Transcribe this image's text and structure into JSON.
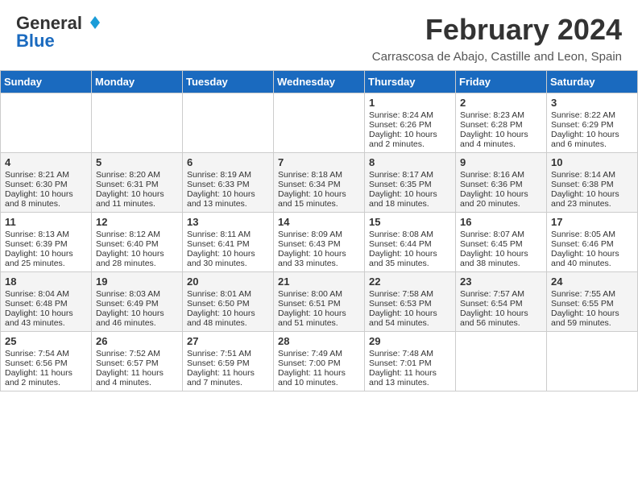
{
  "header": {
    "logo_general": "General",
    "logo_blue": "Blue",
    "month_title": "February 2024",
    "location": "Carrascosa de Abajo, Castille and Leon, Spain"
  },
  "days_of_week": [
    "Sunday",
    "Monday",
    "Tuesday",
    "Wednesday",
    "Thursday",
    "Friday",
    "Saturday"
  ],
  "weeks": [
    [
      {
        "day": "",
        "content": ""
      },
      {
        "day": "",
        "content": ""
      },
      {
        "day": "",
        "content": ""
      },
      {
        "day": "",
        "content": ""
      },
      {
        "day": "1",
        "content": "Sunrise: 8:24 AM\nSunset: 6:26 PM\nDaylight: 10 hours\nand 2 minutes."
      },
      {
        "day": "2",
        "content": "Sunrise: 8:23 AM\nSunset: 6:28 PM\nDaylight: 10 hours\nand 4 minutes."
      },
      {
        "day": "3",
        "content": "Sunrise: 8:22 AM\nSunset: 6:29 PM\nDaylight: 10 hours\nand 6 minutes."
      }
    ],
    [
      {
        "day": "4",
        "content": "Sunrise: 8:21 AM\nSunset: 6:30 PM\nDaylight: 10 hours\nand 8 minutes."
      },
      {
        "day": "5",
        "content": "Sunrise: 8:20 AM\nSunset: 6:31 PM\nDaylight: 10 hours\nand 11 minutes."
      },
      {
        "day": "6",
        "content": "Sunrise: 8:19 AM\nSunset: 6:33 PM\nDaylight: 10 hours\nand 13 minutes."
      },
      {
        "day": "7",
        "content": "Sunrise: 8:18 AM\nSunset: 6:34 PM\nDaylight: 10 hours\nand 15 minutes."
      },
      {
        "day": "8",
        "content": "Sunrise: 8:17 AM\nSunset: 6:35 PM\nDaylight: 10 hours\nand 18 minutes."
      },
      {
        "day": "9",
        "content": "Sunrise: 8:16 AM\nSunset: 6:36 PM\nDaylight: 10 hours\nand 20 minutes."
      },
      {
        "day": "10",
        "content": "Sunrise: 8:14 AM\nSunset: 6:38 PM\nDaylight: 10 hours\nand 23 minutes."
      }
    ],
    [
      {
        "day": "11",
        "content": "Sunrise: 8:13 AM\nSunset: 6:39 PM\nDaylight: 10 hours\nand 25 minutes."
      },
      {
        "day": "12",
        "content": "Sunrise: 8:12 AM\nSunset: 6:40 PM\nDaylight: 10 hours\nand 28 minutes."
      },
      {
        "day": "13",
        "content": "Sunrise: 8:11 AM\nSunset: 6:41 PM\nDaylight: 10 hours\nand 30 minutes."
      },
      {
        "day": "14",
        "content": "Sunrise: 8:09 AM\nSunset: 6:43 PM\nDaylight: 10 hours\nand 33 minutes."
      },
      {
        "day": "15",
        "content": "Sunrise: 8:08 AM\nSunset: 6:44 PM\nDaylight: 10 hours\nand 35 minutes."
      },
      {
        "day": "16",
        "content": "Sunrise: 8:07 AM\nSunset: 6:45 PM\nDaylight: 10 hours\nand 38 minutes."
      },
      {
        "day": "17",
        "content": "Sunrise: 8:05 AM\nSunset: 6:46 PM\nDaylight: 10 hours\nand 40 minutes."
      }
    ],
    [
      {
        "day": "18",
        "content": "Sunrise: 8:04 AM\nSunset: 6:48 PM\nDaylight: 10 hours\nand 43 minutes."
      },
      {
        "day": "19",
        "content": "Sunrise: 8:03 AM\nSunset: 6:49 PM\nDaylight: 10 hours\nand 46 minutes."
      },
      {
        "day": "20",
        "content": "Sunrise: 8:01 AM\nSunset: 6:50 PM\nDaylight: 10 hours\nand 48 minutes."
      },
      {
        "day": "21",
        "content": "Sunrise: 8:00 AM\nSunset: 6:51 PM\nDaylight: 10 hours\nand 51 minutes."
      },
      {
        "day": "22",
        "content": "Sunrise: 7:58 AM\nSunset: 6:53 PM\nDaylight: 10 hours\nand 54 minutes."
      },
      {
        "day": "23",
        "content": "Sunrise: 7:57 AM\nSunset: 6:54 PM\nDaylight: 10 hours\nand 56 minutes."
      },
      {
        "day": "24",
        "content": "Sunrise: 7:55 AM\nSunset: 6:55 PM\nDaylight: 10 hours\nand 59 minutes."
      }
    ],
    [
      {
        "day": "25",
        "content": "Sunrise: 7:54 AM\nSunset: 6:56 PM\nDaylight: 11 hours\nand 2 minutes."
      },
      {
        "day": "26",
        "content": "Sunrise: 7:52 AM\nSunset: 6:57 PM\nDaylight: 11 hours\nand 4 minutes."
      },
      {
        "day": "27",
        "content": "Sunrise: 7:51 AM\nSunset: 6:59 PM\nDaylight: 11 hours\nand 7 minutes."
      },
      {
        "day": "28",
        "content": "Sunrise: 7:49 AM\nSunset: 7:00 PM\nDaylight: 11 hours\nand 10 minutes."
      },
      {
        "day": "29",
        "content": "Sunrise: 7:48 AM\nSunset: 7:01 PM\nDaylight: 11 hours\nand 13 minutes."
      },
      {
        "day": "",
        "content": ""
      },
      {
        "day": "",
        "content": ""
      }
    ]
  ]
}
